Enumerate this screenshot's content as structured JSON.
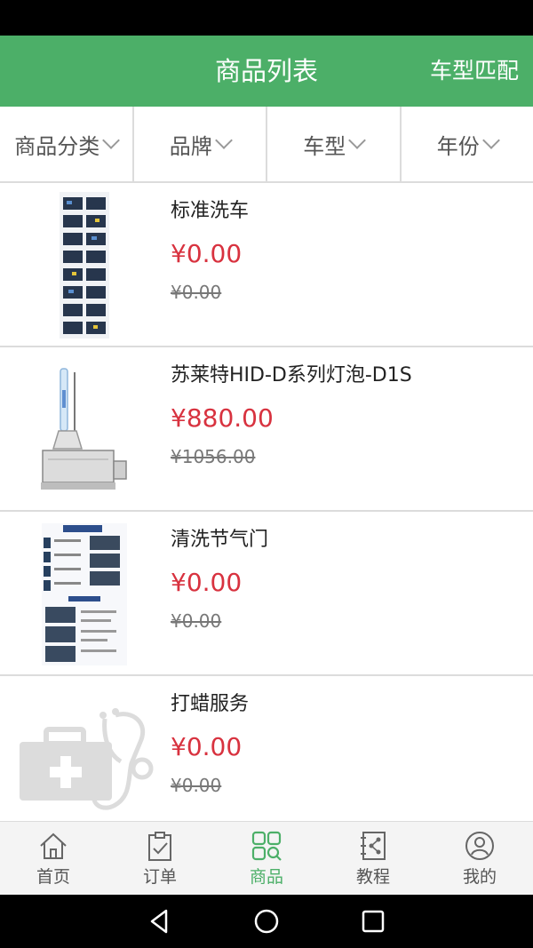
{
  "header": {
    "title": "商品列表",
    "action": "车型匹配"
  },
  "filters": [
    {
      "label": "商品分类"
    },
    {
      "label": "品牌"
    },
    {
      "label": "车型"
    },
    {
      "label": "年份"
    }
  ],
  "products": [
    {
      "name": "标准洗车",
      "price": "¥0.00",
      "original_price": "¥0.00",
      "thumb_icon": "car-wash-poster-icon"
    },
    {
      "name": "苏莱特HID-D系列灯泡-D1S",
      "price": "¥880.00",
      "original_price": "¥1056.00",
      "thumb_icon": "hid-bulb-icon"
    },
    {
      "name": "清洗节气门",
      "price": "¥0.00",
      "original_price": "¥0.00",
      "thumb_icon": "throttle-cleaning-poster-icon"
    },
    {
      "name": "打蜡服务",
      "price": "¥0.00",
      "original_price": "¥0.00",
      "thumb_icon": "medical-kit-placeholder-icon"
    }
  ],
  "tabbar": {
    "items": [
      {
        "label": "首页",
        "icon": "home-icon"
      },
      {
        "label": "订单",
        "icon": "clipboard-check-icon"
      },
      {
        "label": "商品",
        "icon": "grid-search-icon",
        "active": true
      },
      {
        "label": "教程",
        "icon": "notebook-share-icon"
      },
      {
        "label": "我的",
        "icon": "user-circle-icon"
      }
    ]
  },
  "colors": {
    "primary": "#4caf68",
    "price": "#d8323f"
  }
}
